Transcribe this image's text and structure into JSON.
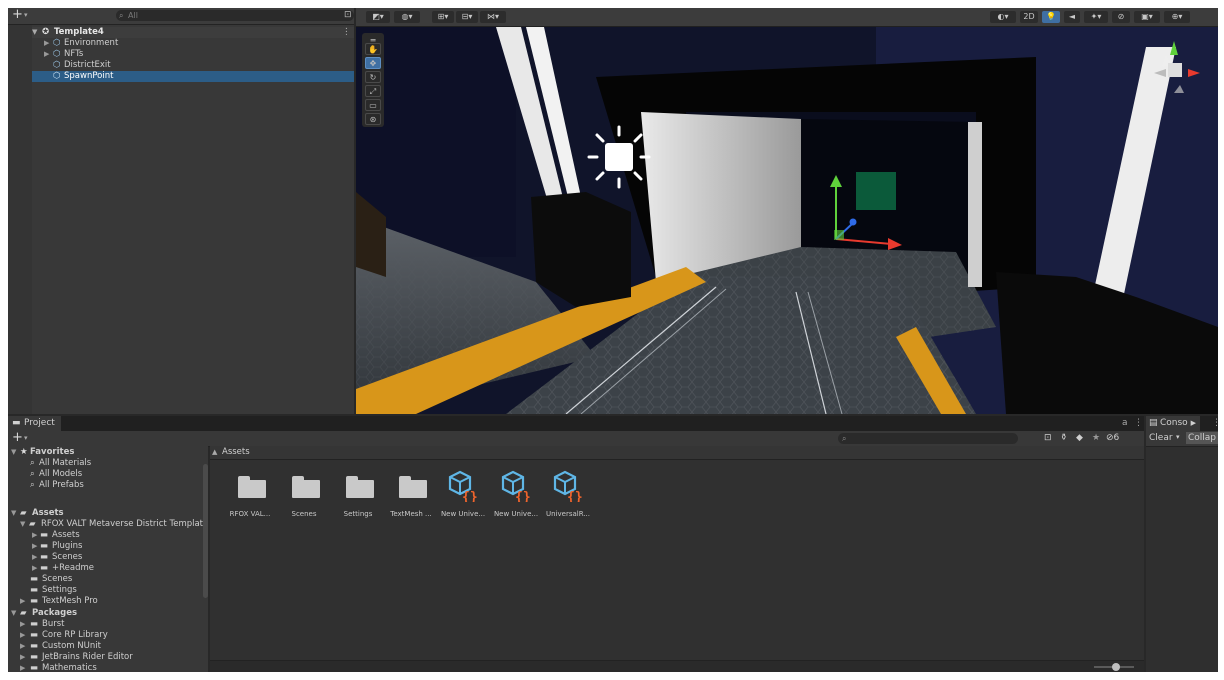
{
  "hierarchy": {
    "add_label": "+",
    "search_placeholder": "All",
    "scene_name": "Template4",
    "items": [
      {
        "label": "Environment"
      },
      {
        "label": "NFTs"
      },
      {
        "label": "DistrictExit"
      },
      {
        "label": "SpawnPoint",
        "selected": true
      }
    ]
  },
  "scene_toolbar": {
    "mode_2d": "2D"
  },
  "project": {
    "tab_label": "Project",
    "add_label": "+",
    "hidden_count": "6",
    "favorites": {
      "title": "Favorites",
      "items": [
        "All Materials",
        "All Models",
        "All Prefabs"
      ]
    },
    "assets_tree": {
      "title": "Assets",
      "root": "RFOX VALT Metaverse District Templat",
      "children": [
        "Assets",
        "Plugins",
        "Scenes",
        "+Readme"
      ],
      "siblings": [
        "Scenes",
        "Settings",
        "TextMesh Pro"
      ]
    },
    "packages": {
      "title": "Packages",
      "items": [
        "Burst",
        "Core RP Library",
        "Custom NUnit",
        "JetBrains Rider Editor",
        "Mathematics"
      ]
    },
    "breadcrumb": "Assets",
    "assets": [
      {
        "label": "RFOX VAL...",
        "type": "folder"
      },
      {
        "label": "Scenes",
        "type": "folder"
      },
      {
        "label": "Settings",
        "type": "folder"
      },
      {
        "label": "TextMesh ...",
        "type": "folder"
      },
      {
        "label": "New Unive...",
        "type": "pipeline"
      },
      {
        "label": "New Unive...",
        "type": "pipeline"
      },
      {
        "label": "UniversalR...",
        "type": "pipeline"
      }
    ]
  },
  "console": {
    "tab_label": "Conso",
    "clear_label": "Clear",
    "collapse_label": "Collap"
  },
  "colors": {
    "selection": "#2c5d87",
    "accent_blue": "#5fb6e6",
    "accent_orange": "#f0642c",
    "yellow_floor": "#d8961a"
  }
}
